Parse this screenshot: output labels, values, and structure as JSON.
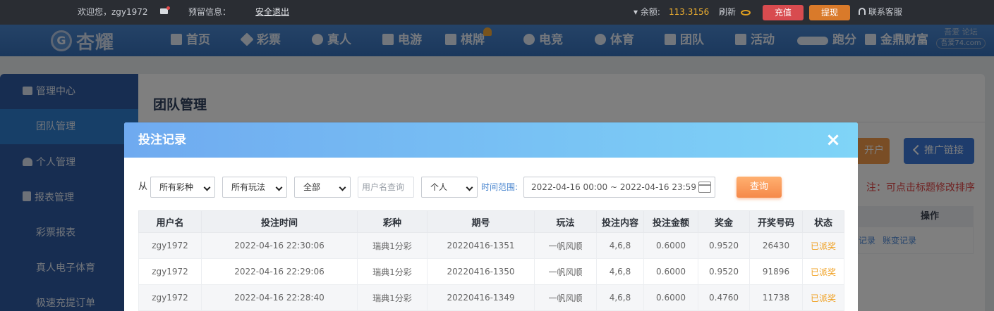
{
  "topbar": {
    "welcome": "欢迎您，zgy1972",
    "reserved_info_label": "预留信息：",
    "logout_label": "安全退出",
    "balance_label": "余额:",
    "balance_value": "113.3156",
    "refresh_label": "刷新",
    "recharge_label": "充值",
    "withdraw_label": "提现",
    "support_label": "联系客服"
  },
  "nav": {
    "logo_text": "杏耀",
    "items": [
      "首页",
      "彩票",
      "真人",
      "电游",
      "棋牌",
      "电竞",
      "体育",
      "团队",
      "活动",
      "跑分",
      "金鼎财富"
    ]
  },
  "watermark": {
    "line1": "吾爱  论坛",
    "url": "吾爱74.com"
  },
  "sidebar": {
    "items": [
      {
        "label": "管理中心",
        "kind": "head"
      },
      {
        "label": "团队管理",
        "kind": "sub-active"
      },
      {
        "label": "个人管理",
        "kind": "head"
      },
      {
        "label": "报表管理",
        "kind": "head"
      },
      {
        "label": "彩票报表",
        "kind": "sub"
      },
      {
        "label": "真人电子体育",
        "kind": "sub"
      },
      {
        "label": "极速充提订单",
        "kind": "sub"
      }
    ]
  },
  "page": {
    "title": "团队管理",
    "open_account_label": "开户",
    "promo_link_label": "推广链接",
    "note": "注：可点击标题修改排序",
    "ops_header": "操作",
    "ops_links": [
      "记录",
      "账变记录"
    ]
  },
  "modal": {
    "title": "投注记录",
    "close_icon": "×",
    "filters": {
      "from_label": "从",
      "lottery_select": "所有彩种",
      "play_select": "所有玩法",
      "status_select": "全部",
      "username_placeholder": "用户名查询",
      "scope_select": "个人",
      "range_label": "时间范围:",
      "range_value": "2022-04-16 00:00 ~ 2022-04-16 23:59",
      "query_label": "查询"
    },
    "table": {
      "columns": [
        "用户名",
        "投注时间",
        "彩种",
        "期号",
        "玩法",
        "投注内容",
        "投注金额",
        "奖金",
        "开奖号码",
        "状态"
      ],
      "rows": [
        [
          "zgy1972",
          "2022-04-16 22:30:06",
          "瑞典1分彩",
          "20220416-1351",
          "一帆风顺",
          "4,6,8",
          "0.6000",
          "0.9520",
          "26430",
          "已派奖"
        ],
        [
          "zgy1972",
          "2022-04-16 22:29:06",
          "瑞典1分彩",
          "20220416-1350",
          "一帆风顺",
          "4,6,8",
          "0.6000",
          "0.9520",
          "91896",
          "已派奖"
        ],
        [
          "zgy1972",
          "2022-04-16 22:28:40",
          "瑞典1分彩",
          "20220416-1349",
          "一帆风顺",
          "4,6,8",
          "0.6000",
          "0.4760",
          "11738",
          "已派奖"
        ]
      ]
    }
  },
  "colors": {
    "accent_blue": "#3670b9",
    "modal_header": "#7fd4f7",
    "status_paid": "#f0a020",
    "note_red": "#e04444"
  }
}
